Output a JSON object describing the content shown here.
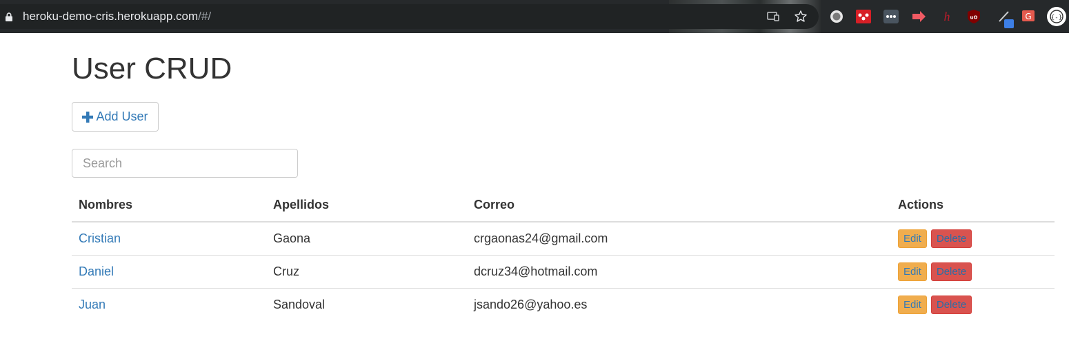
{
  "browser": {
    "url_host": "heroku-demo-cris.herokuapp.com",
    "url_path": "/#/",
    "colors": {
      "chrome_bg": "#26292b",
      "omnibox_bg": "#202324"
    },
    "extensions": [
      "record-icon",
      "mendeley-icon",
      "more-dots-icon",
      "arrow-extension-icon",
      "hypothesis-icon",
      "ublock-icon",
      "pen-icon",
      "translate-icon",
      "profile-icon"
    ]
  },
  "page": {
    "title": "User CRUD",
    "add_user_label": "Add User",
    "search": {
      "placeholder": "Search",
      "value": ""
    },
    "table": {
      "headers": {
        "nombres": "Nombres",
        "apellidos": "Apellidos",
        "correo": "Correo",
        "actions": "Actions"
      },
      "rows": [
        {
          "nombres": "Cristian",
          "apellidos": "Gaona",
          "correo": "crgaonas24@gmail.com",
          "edit": "Edit",
          "delete": "Delete"
        },
        {
          "nombres": "Daniel",
          "apellidos": "Cruz",
          "correo": "dcruz34@hotmail.com",
          "edit": "Edit",
          "delete": "Delete"
        },
        {
          "nombres": "Juan",
          "apellidos": "Sandoval",
          "correo": "jsando26@yahoo.es",
          "edit": "Edit",
          "delete": "Delete"
        }
      ]
    },
    "colors": {
      "link": "#337ab7",
      "warning": "#f0ad4e",
      "danger": "#d9534f"
    }
  }
}
